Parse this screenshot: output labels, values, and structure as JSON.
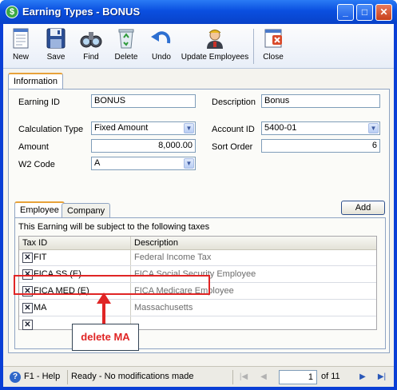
{
  "window": {
    "title": "Earning Types - BONUS",
    "controls": {
      "minimize": "_",
      "maximize": "□",
      "close": "✕"
    }
  },
  "toolbar": {
    "buttons": [
      {
        "label": "New",
        "icon": "new-document-icon"
      },
      {
        "label": "Save",
        "icon": "floppy-disk-icon"
      },
      {
        "label": "Find",
        "icon": "binoculars-icon"
      },
      {
        "label": "Delete",
        "icon": "recycle-bin-icon"
      },
      {
        "label": "Undo",
        "icon": "undo-arrow-icon"
      },
      {
        "label": "Update Employees",
        "icon": "employee-icon"
      },
      {
        "label": "Close",
        "icon": "close-window-icon"
      }
    ]
  },
  "tabs": {
    "information": "Information"
  },
  "form": {
    "earning_id_label": "Earning ID",
    "earning_id_value": "BONUS",
    "description_label": "Description",
    "description_value": "Bonus",
    "calculation_type_label": "Calculation Type",
    "calculation_type_value": "Fixed Amount",
    "account_id_label": "Account ID",
    "account_id_value": "5400-01",
    "amount_label": "Amount",
    "amount_value": "8,000.00",
    "sort_order_label": "Sort Order",
    "sort_order_value": "6",
    "w2_code_label": "W2 Code",
    "w2_code_value": "A"
  },
  "subtabs": {
    "employee": "Employee",
    "company": "Company"
  },
  "add_button": "Add",
  "taxes": {
    "caption": "This Earning will be subject to the following taxes",
    "columns": [
      "Tax ID",
      "Description"
    ],
    "rows": [
      {
        "tax_id": "FIT",
        "description": "Federal Income Tax"
      },
      {
        "tax_id": "FICA SS (E)",
        "description": "FICA Social Security Employee"
      },
      {
        "tax_id": "FICA MED (E)",
        "description": "FICA Medicare Employee"
      },
      {
        "tax_id": "MA",
        "description": "Massachusetts"
      },
      {
        "tax_id": "",
        "description": ""
      }
    ],
    "delete_glyph": "✕"
  },
  "annotation": {
    "text": "delete MA",
    "color": "#e02525"
  },
  "status": {
    "help": "F1 - Help",
    "message": "Ready - No modifications made",
    "page": "1",
    "of_label": "of 11"
  },
  "colors": {
    "title_bar": "#0a4fe0",
    "accent_tab": "#e7a23a",
    "nav_active": "#2957b8"
  }
}
